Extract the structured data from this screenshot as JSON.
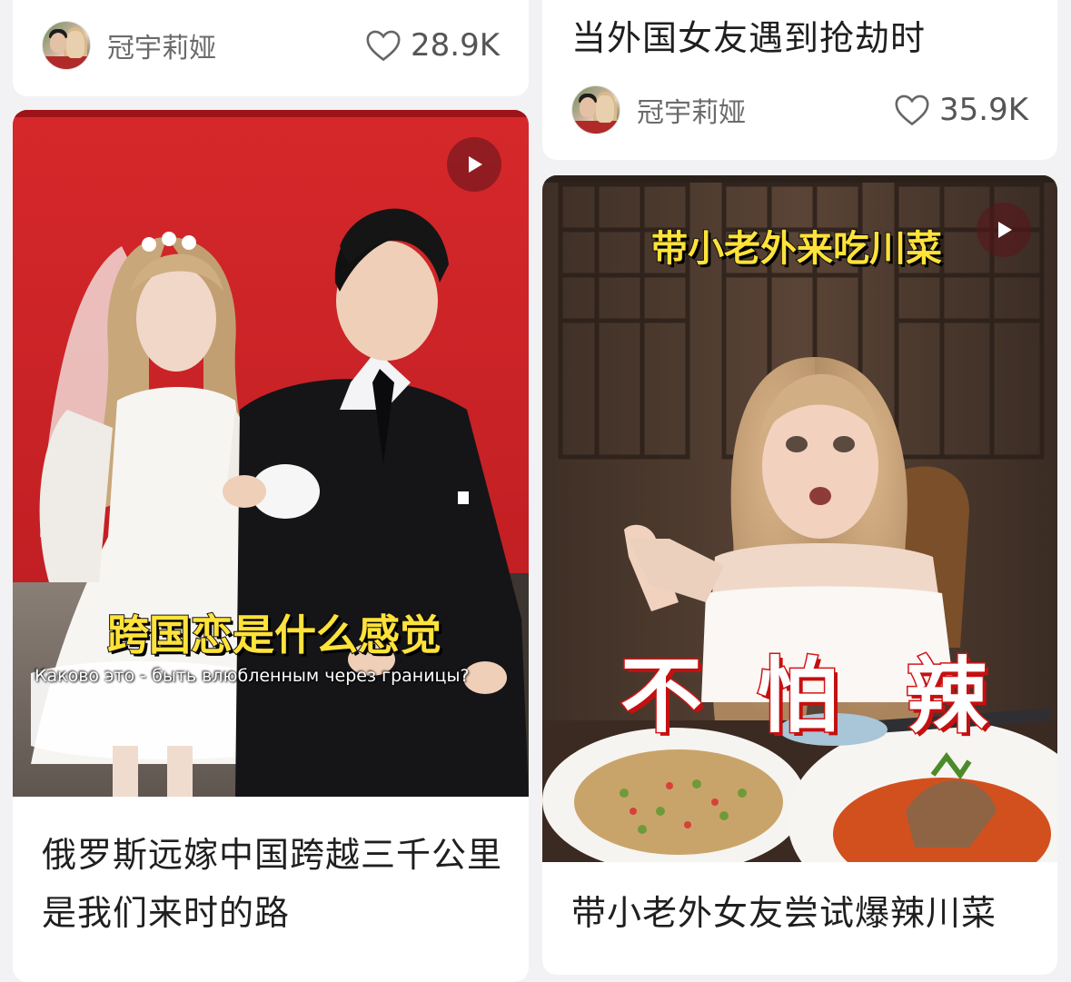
{
  "cards": [
    {
      "author": "冠宇莉娅",
      "likes": "28.9K"
    },
    {
      "title": "俄罗斯远嫁中国跨越三千公里是我们来时的路",
      "overlay_cn": "跨国恋是什么感觉",
      "overlay_ru": "Каково это - быть влюбленным через границы?"
    },
    {
      "title": "当外国女友遇到抢劫时",
      "author": "冠宇莉娅",
      "likes": "35.9K"
    },
    {
      "title": "带小老外女友尝试爆辣川菜",
      "overlay_top": "带小老外来吃川菜",
      "overlay_big": [
        "不",
        "怕",
        "辣"
      ]
    }
  ],
  "icons": {
    "like": "heart-outline-icon",
    "play": "play-icon"
  },
  "colors": {
    "background": "#f2f2f4",
    "card": "#ffffff",
    "overlay_yellow": "#ffe23a",
    "overlay_red": "#d51414",
    "wedding_backdrop": "#cf1f24"
  }
}
